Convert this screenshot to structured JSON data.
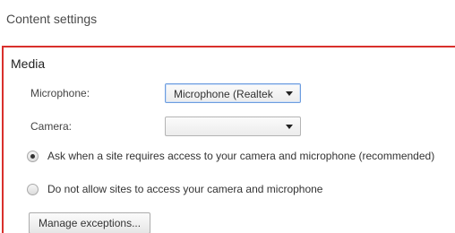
{
  "page": {
    "title": "Content settings"
  },
  "media": {
    "title": "Media",
    "microphone": {
      "label": "Microphone:",
      "selected": "Microphone (Realtek"
    },
    "camera": {
      "label": "Camera:",
      "selected": ""
    },
    "options": [
      {
        "label": "Ask when a site requires access to your camera and microphone (recommended)",
        "checked": true
      },
      {
        "label": "Do not allow sites to access your camera and microphone",
        "checked": false
      }
    ],
    "manage_exceptions_label": "Manage exceptions..."
  },
  "colors": {
    "highlight_border": "#d9302c",
    "focus_border": "#6d9ddf"
  },
  "icons": {
    "select_caret": "chevron-down-icon",
    "radio_selected": "radio-selected-icon",
    "radio_unselected": "radio-unselected-icon"
  }
}
